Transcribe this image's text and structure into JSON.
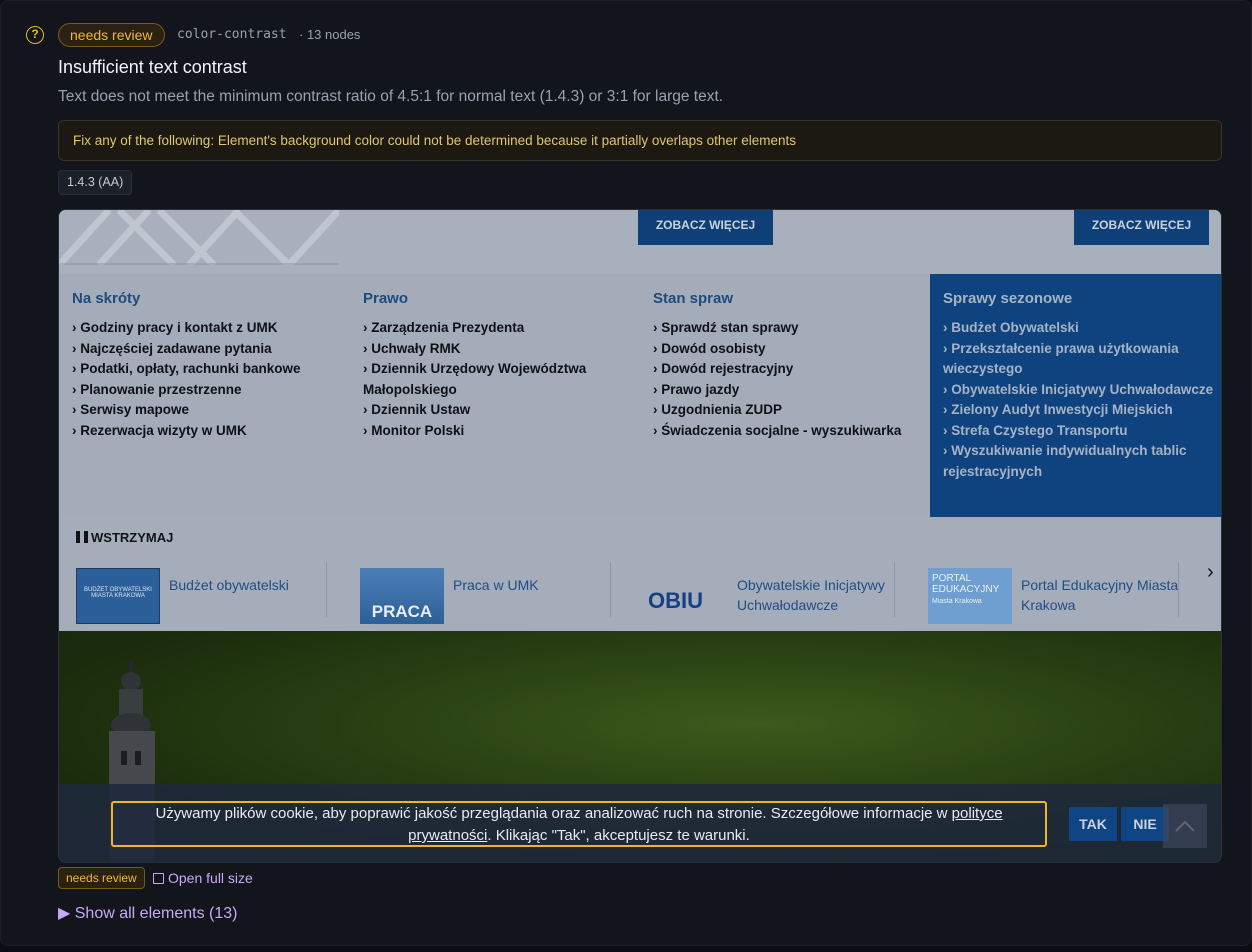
{
  "header": {
    "help_icon": "question-circle-icon",
    "status_badge": "needs review",
    "rule_id": "color-contrast",
    "node_count": "· 13 nodes",
    "title": "Insufficient text contrast",
    "description": "Text does not meet the minimum contrast ratio of 4.5:1 for normal text (1.4.3) or 3:1 for large text.",
    "fix_message": "Fix any of the following: Element's background color could not be determined because it partially overlaps other elements",
    "wcag_tag": "1.4.3 (AA)"
  },
  "screenshot": {
    "top_buttons": [
      "ZOBACZ WIĘCEJ",
      "ZOBACZ WIĘCEJ"
    ],
    "columns": [
      {
        "title": "Na skróty",
        "items": [
          "Godziny pracy i kontakt z UMK",
          "Najczęściej zadawane pytania",
          "Podatki, opłaty, rachunki bankowe",
          "Planowanie przestrzenne",
          "Serwisy mapowe",
          "Rezerwacja wizyty w UMK"
        ]
      },
      {
        "title": "Prawo",
        "items": [
          "Zarządzenia Prezydenta",
          "Uchwały RMK",
          "Dziennik Urzędowy Województwa Małopolskiego",
          "Dziennik Ustaw",
          "Monitor Polski"
        ]
      },
      {
        "title": "Stan spraw",
        "items": [
          "Sprawdź stan sprawy",
          "Dowód osobisty",
          "Dowód rejestracyjny",
          "Prawo jazdy",
          "Uzgodnienia ZUDP",
          "Świadczenia socjalne - wyszukiwarka"
        ]
      },
      {
        "title": "Sprawy sezonowe",
        "items": [
          "Budżet Obywatelski",
          "Przekształcenie prawa użytkowania wieczystego",
          "Obywatelskie Inicjatywy Uchwałodawcze",
          "Zielony Audyt Inwestycji Miejskich",
          "Strefa Czystego Transportu",
          "Wyszukiwanie indywidualnych tablic rejestracyjnych"
        ]
      }
    ],
    "pause_label": "WSTRZYMAJ",
    "tiles": [
      {
        "label": "Budżet obywatelski",
        "thumb_text": "BUDŻET OBYWATELSKI MIASTA KRAKOWA"
      },
      {
        "label": "Praca w UMK",
        "thumb_text": "PRACA"
      },
      {
        "label": "Obywatelskie Inicjatywy Uchwałodawcze",
        "thumb_text": "OBIU"
      },
      {
        "label": "Portal Edukacyjny Miasta Krakowa",
        "thumb_text": "PORTAL EDUKACYJNY",
        "thumb_sub": "Miasta Krakowa"
      }
    ],
    "cookie": {
      "text_before": "Używamy plików cookie, aby poprawić jakość przeglądania oraz analizować ruch na stronie. Szczegółowe informacje w ",
      "link": "polityce prywatności",
      "text_after": ". Klikając \"Tak\", akceptujesz te warunki.",
      "yes": "TAK",
      "no": "NIE"
    }
  },
  "footer": {
    "status_badge": "needs review",
    "open_full": "Open full size",
    "show_all": "▶ Show all elements (13)"
  },
  "colors": {
    "accent_warning": "#f3b835",
    "link_purple": "#c9a7f7",
    "site_blue": "#0e4380"
  }
}
